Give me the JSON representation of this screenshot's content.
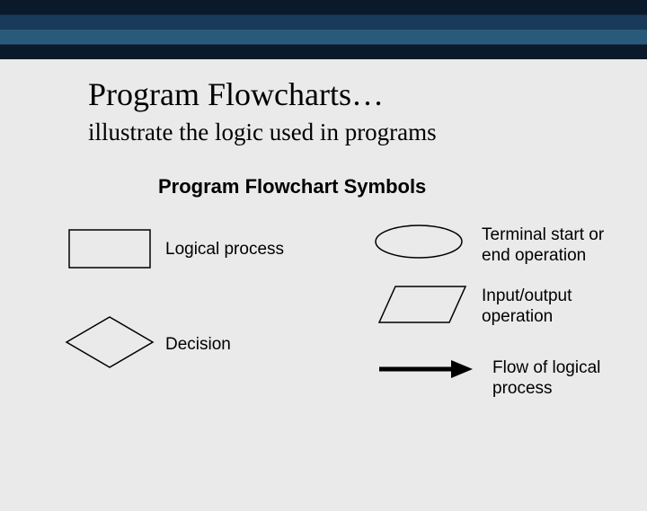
{
  "title": "Program Flowcharts…",
  "subtitle": "illustrate the logic used in programs",
  "section_title": "Program Flowchart Symbols",
  "symbols": {
    "logical_process": "Logical process",
    "terminal": "Terminal start or end operation",
    "input_output": "Input/output operation",
    "decision": "Decision",
    "flow": "Flow of logical process"
  }
}
